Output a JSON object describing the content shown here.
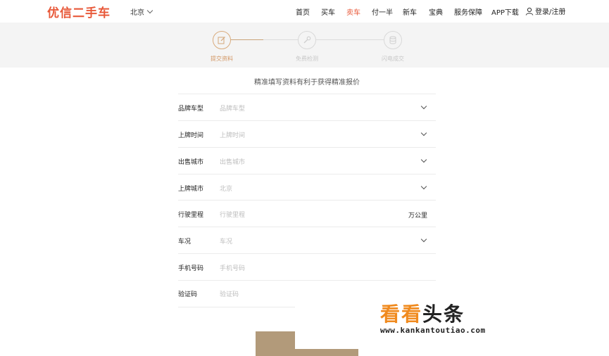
{
  "header": {
    "logo": "优信二手车",
    "city": "北京",
    "nav": [
      {
        "label": "首页",
        "active": false
      },
      {
        "label": "买车",
        "active": false
      },
      {
        "label": "卖车",
        "active": true
      },
      {
        "label": "付一半",
        "active": false
      },
      {
        "label": "新车",
        "active": false
      },
      {
        "label": "宝典",
        "active": false
      },
      {
        "label": "服务保障",
        "active": false
      },
      {
        "label": "APP下载",
        "active": false
      }
    ],
    "login": "登录/注册"
  },
  "steps": [
    {
      "label": "提交资料",
      "icon": "edit-icon",
      "active": true
    },
    {
      "label": "免费检测",
      "icon": "wrench-icon",
      "active": false
    },
    {
      "label": "闪电成交",
      "icon": "database-icon",
      "active": false
    }
  ],
  "form": {
    "title": "精准填写资料有利于获得精准报价",
    "rows": [
      {
        "label": "品牌车型",
        "placeholder": "品牌车型",
        "type": "select"
      },
      {
        "label": "上牌时间",
        "placeholder": "上牌时间",
        "type": "select"
      },
      {
        "label": "出售城市",
        "placeholder": "出售城市",
        "type": "select"
      },
      {
        "label": "上牌城市",
        "placeholder": "北京",
        "type": "select"
      },
      {
        "label": "行驶里程",
        "placeholder": "行驶里程",
        "type": "unit",
        "unit": "万公里"
      },
      {
        "label": "车况",
        "placeholder": "车况",
        "type": "select"
      },
      {
        "label": "手机号码",
        "placeholder": "手机号码",
        "type": "text"
      },
      {
        "label": "验证码",
        "placeholder": "验证码",
        "type": "text"
      }
    ]
  },
  "watermark": {
    "main_a": "看看",
    "main_b": "头条",
    "url": "www.kankantoutiao.com"
  },
  "colors": {
    "accent": "#e8593a",
    "step_active": "#d29663",
    "submit": "#b29a7a"
  }
}
